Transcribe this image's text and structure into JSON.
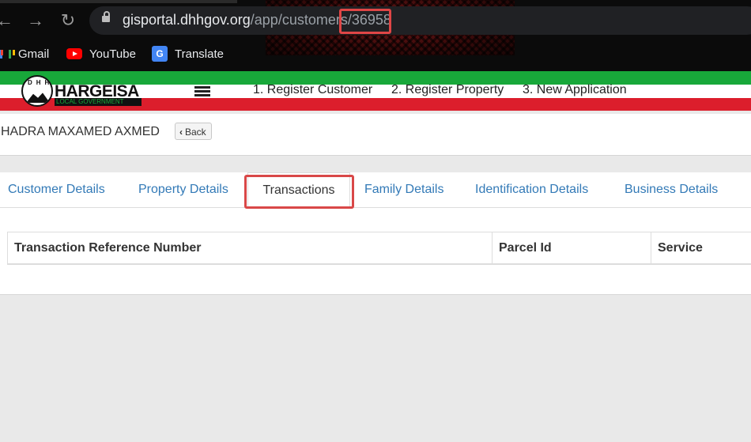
{
  "browser": {
    "url_host": "gisportal.dhhgov.org",
    "url_path": "/app/customers/36958",
    "bookmarks": [
      {
        "label": "Gmail",
        "icon": "gmail-icon"
      },
      {
        "label": "YouTube",
        "icon": "youtube-icon"
      },
      {
        "label": "Translate",
        "icon": "google-translate-icon"
      }
    ],
    "highlight_color": "#e04646"
  },
  "header": {
    "logo_name": "HARGEISA",
    "logo_sub": "LOCAL GOVERNMENT",
    "logo_letters": "DHH",
    "nav": [
      "1. Register Customer",
      "2. Register Property",
      "3. New Application"
    ],
    "flag_colors": {
      "green": "#18a83a",
      "white": "#ffffff",
      "red": "#dc1e2c"
    }
  },
  "page": {
    "customer_name": "HADRA MAXAMED AXMED",
    "back_label": "Back"
  },
  "tabs": [
    {
      "label": "Customer Details",
      "active": false
    },
    {
      "label": "Property Details",
      "active": false
    },
    {
      "label": "Transactions",
      "active": true
    },
    {
      "label": "Family Details",
      "active": false
    },
    {
      "label": "Identification Details",
      "active": false
    },
    {
      "label": "Business Details",
      "active": false
    }
  ],
  "table": {
    "columns": [
      "Transaction Reference Number",
      "Parcel Id",
      "Service"
    ],
    "rows": []
  },
  "link_color": "#337ab7"
}
